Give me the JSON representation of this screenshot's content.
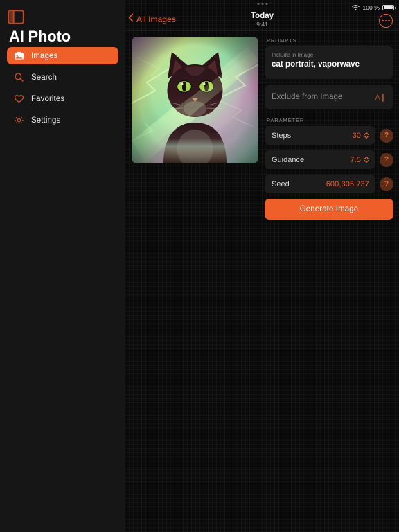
{
  "app": {
    "title": "AI Photo",
    "sidebar_toggle_icon": "sidebar-toggle-icon"
  },
  "sidebar": {
    "items": [
      {
        "label": "Images",
        "icon": "photo-icon",
        "active": true
      },
      {
        "label": "Search",
        "icon": "search-icon",
        "active": false
      },
      {
        "label": "Favorites",
        "icon": "heart-icon",
        "active": false
      },
      {
        "label": "Settings",
        "icon": "gear-icon",
        "active": false
      }
    ]
  },
  "statusbar": {
    "battery_percent": "100 %",
    "wifi_icon": "wifi-icon",
    "multitask_icon": "multitask-dots-icon"
  },
  "navbar": {
    "back_label": "All Images",
    "back_icon": "chevron-left-icon",
    "title": "Today",
    "subtitle": "9:41",
    "more_icon": "more-ellipsis-icon"
  },
  "preview": {
    "alt": "generated cat portrait vaporwave"
  },
  "prompts": {
    "section_label": "PROMPTS",
    "include": {
      "caption": "Include in Image",
      "value": "cat portrait, vaporwave"
    },
    "exclude": {
      "placeholder": "Exclude from Image",
      "dictate_icon": "text-cursor-icon",
      "dictate_glyph": "A❙"
    }
  },
  "parameters": {
    "section_label": "PARAMETER",
    "help_glyph": "?",
    "stepper_up": "▴",
    "stepper_down": "▾",
    "rows": [
      {
        "name": "Steps",
        "value": "30",
        "has_stepper": true
      },
      {
        "name": "Guidance",
        "value": "7.5",
        "has_stepper": true
      },
      {
        "name": "Seed",
        "value": "600,305,737",
        "has_stepper": false
      }
    ]
  },
  "actions": {
    "generate_label": "Generate Image"
  },
  "colors": {
    "accent": "#ef5f2a",
    "sidebar_bg": "#161616",
    "main_bg": "#0a0a0a",
    "card_bg": "#1c1c1c"
  }
}
